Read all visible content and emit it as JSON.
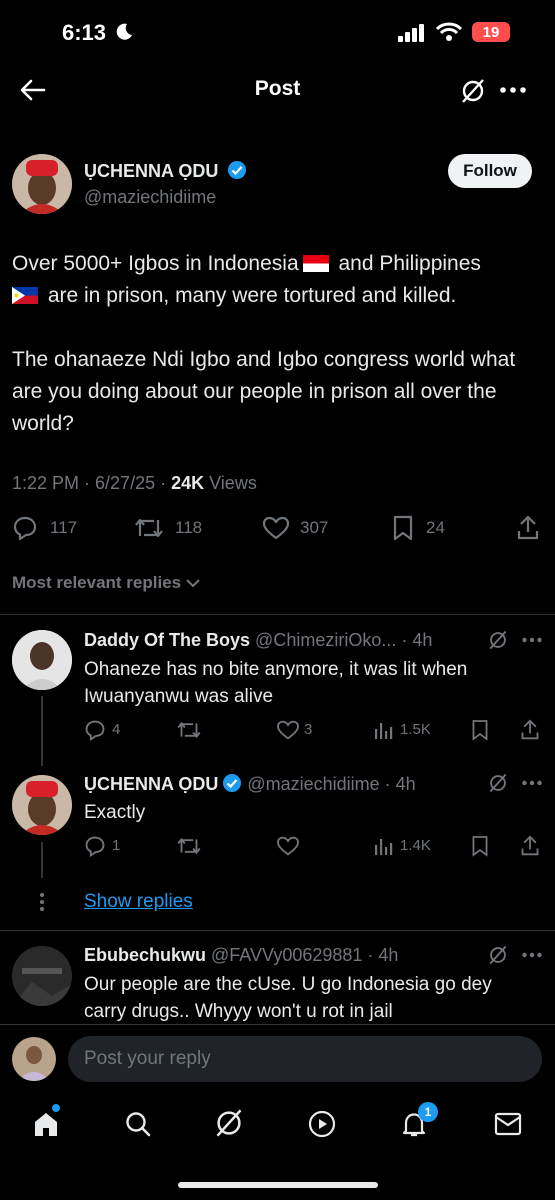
{
  "status_bar": {
    "time": "6:13",
    "battery": "19"
  },
  "header": {
    "title": "Post"
  },
  "author": {
    "name": "ỤCHENNA ỌDU",
    "handle": "@maziechidiime",
    "follow_label": "Follow"
  },
  "tweet": {
    "text": "Over 5000+ Igbos in Indonesia",
    "text_2": " and Philippines",
    "text_3": " are in prison, many were tortured and killed.\n\nThe ohanaeze Ndi Igbo and Igbo congress world what are you doing about our people in prison all over the world?",
    "time": "1:22 PM · 6/27/25 · ",
    "views_count": "24K",
    "views_label": " Views"
  },
  "actions": {
    "replies": "117",
    "reposts": "118",
    "likes": "307",
    "bookmarks": "24"
  },
  "sort_label": "Most relevant replies",
  "replies": [
    {
      "name": "Daddy Of The Boys",
      "handle": "@ChimeziriOko...",
      "time": " · 4h",
      "text": "Ohaneze has no bite anymore, it was lit when Iwuanyanwu was alive",
      "reply_count": "4",
      "repost_count": "",
      "like_count": "3",
      "views": "1.5K"
    },
    {
      "name": "ỤCHENNA ỌDU",
      "handle": "@maziechidiime",
      "time": " · 4h",
      "text": "Exactly",
      "reply_count": "1",
      "repost_count": "",
      "like_count": "",
      "views": "1.4K"
    },
    {
      "name": "Ebubechukwu",
      "handle": "@FAVVy00629881",
      "time": " · 4h",
      "text": "Our people are the cUse. U go Indonesia go dey carry drugs.. Whyyy won't u rot in jail"
    }
  ],
  "show_replies_label": "Show replies",
  "reply_placeholder": "Post your reply",
  "bottom_nav": {
    "notification_badge": "1"
  },
  "colors": {
    "accent": "#1d9bf0",
    "background": "#000000",
    "battery": "#ff4d4d"
  }
}
